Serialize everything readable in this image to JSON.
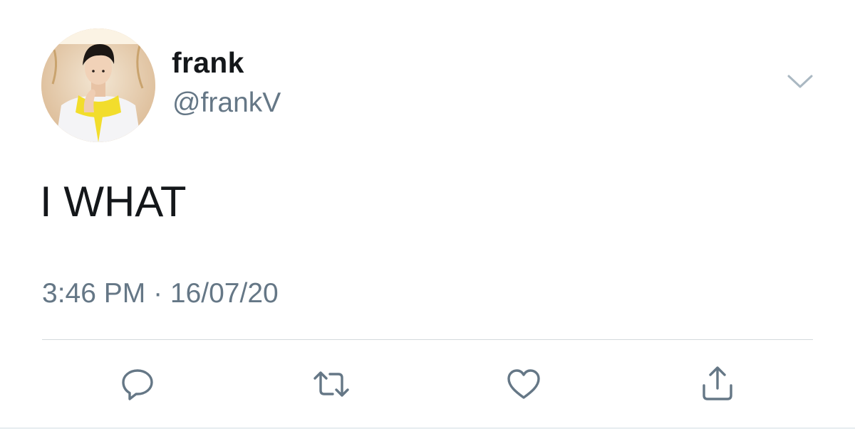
{
  "user": {
    "display_name": "frank",
    "handle": "@frankV"
  },
  "tweet": {
    "text": "I WHAT",
    "timestamp": "3:46 PM · 16/07/20"
  },
  "icons": {
    "menu": "chevron-down-icon",
    "reply": "reply-icon",
    "retweet": "retweet-icon",
    "like": "heart-icon",
    "share": "share-icon"
  },
  "colors": {
    "primary_text": "#14171a",
    "secondary_text": "#657786",
    "icon": "#657786",
    "divider": "#d4d9dd"
  }
}
